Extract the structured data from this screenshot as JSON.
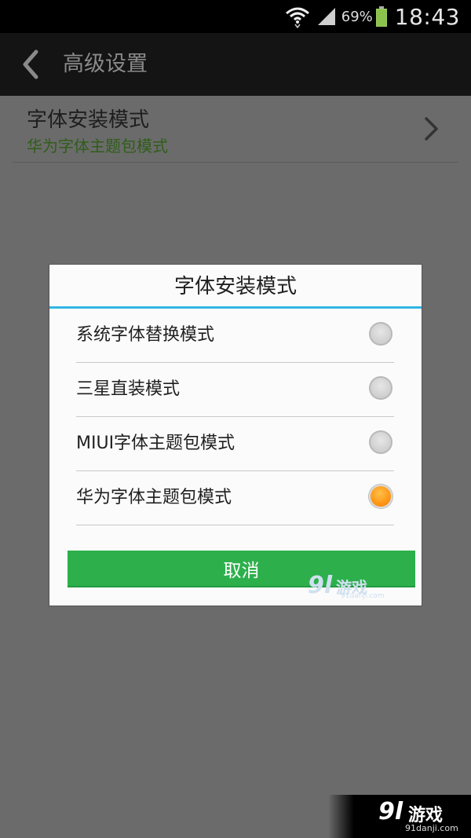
{
  "status_bar": {
    "battery_percent": "69%",
    "time": "18:43",
    "icons": [
      "wifi-icon",
      "signal-icon",
      "battery-icon"
    ]
  },
  "header": {
    "title": "高级设置",
    "back_icon": "back-arrow-icon"
  },
  "setting": {
    "title": "字体安装模式",
    "value": "华为字体主题包模式",
    "chevron_icon": "chevron-right-icon"
  },
  "dialog": {
    "title": "字体安装模式",
    "options": [
      {
        "label": "系统字体替换模式",
        "selected": false
      },
      {
        "label": "三星直装模式",
        "selected": false
      },
      {
        "label": "MIUI字体主题包模式",
        "selected": false
      },
      {
        "label": "华为字体主题包模式",
        "selected": true
      }
    ],
    "cancel_label": "取消"
  },
  "watermark": {
    "logo": "9l",
    "text": "游戏",
    "url": "91danji.com"
  },
  "colors": {
    "accent_blue": "#33b5e5",
    "button_green": "#2db04c",
    "selected_orange": "#ff9a1a",
    "subtitle_green": "#2f5e19"
  }
}
